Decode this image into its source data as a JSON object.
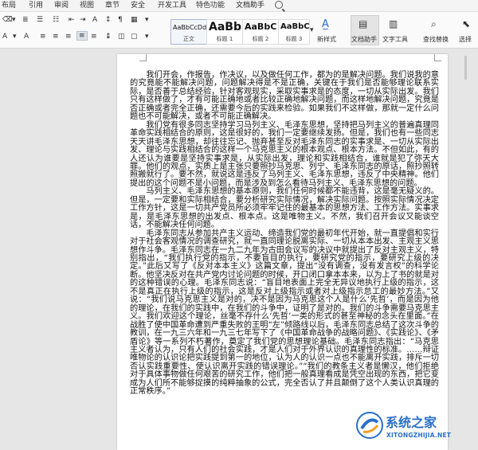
{
  "menu": {
    "items": [
      "布局",
      "引用",
      "审阅",
      "视图",
      "章节",
      "安全",
      "开发工具",
      "特色功能",
      "文档助手"
    ]
  },
  "ribbon": {
    "styles": [
      {
        "sample": "AaBbCcDd",
        "label": "正文"
      },
      {
        "sample": "AaBb",
        "label": "标题 1"
      },
      {
        "sample": "AaBbC",
        "label": "标题 2"
      },
      {
        "sample": "AaBbC",
        "label": "标题 3"
      }
    ],
    "new_style_label": "新样式",
    "doc_assistant_label": "文档助手",
    "text_tools_label": "文字工具",
    "find_replace_label": "查找替换",
    "select_label": "选择"
  },
  "document": {
    "paragraphs": [
      "我们开会，作报告，作决议，以及做任何工作，都为的是解决问题。我们说我的意的究竟能不能解决问题，问题解决得是不是正确，关键在于我们是否能够理论联系实际，是否善于总结经验，针对客观现实，采取实事求是的态度，一切从实际出发。我们只有这样做了，才有可能正确地或者比较正确地解决问题，而这样地解决问题，究竟是否正确或者完全正确，还需要今后的实践来检验。如果我们不这样做，那就一定什么问题也不可能解决，或者不可能正确解决。",
      "我们党有很多同志坚持学习马列主义、毛泽东思想，坚持把马列主义的普遍真理同革命实践相结合的原则，这是很好的，我们一定要继续发扬。但是，我们也有一些同志天天讲毛泽东思想，却往往忘记、抛弃甚至反对毛泽东同志的实事求是、一切从实际出发、理论与实践相结合的这样一个马克思主义的根本观点、根本方法。不但如此，有的人还认为谁要是坚持实事求是，从实际出发，理论和实践相结合，谁就是犯了弥天大罪。他们的观点，实质上是主张只要照抄马克思、列宁、毛泽东同志的原话，照抄照转照搬就行了。要不然，就说这是违反了马列主义、毛泽东思想，违反了中央精神。他们提出的这个问题不是小问题，而是涉及到怎么看待马列主义、毛泽东思想的问题。",
      "马列主义、毛泽东思想的基本原则，我们任何时候都不能违背，这是毫无疑义的。但是，一定要和实际相结合，要分析研究实际情况，解决实际问题。按照实际情况决定工作方针，这是一切共产党员所必须牢牢记住的最基本的思想方法、工作方法。实事求是，是毛泽东思想的出发点、根本点。这是唯物主义。不然，我们召开会议又能谈空话，不能解决任何问题。",
      "毛泽东同志从参加共产主义运动、缔造我们党的最初年代开始，就一直提倡和实行对于社会客观情况的调查研究，就一直同理论脱离实际、一切从本本出发、主观主义思想作斗争。毛泽东同志在一九二九年为古田会议写的决议中就提出了反对主观主义，特别指出，“我们执行党的指示，不要盲目的执行，要研究党的指示，要研究上级的决定。”此后又写了《反对本本主义》这篇文章，提出“没有调查，没有发言权”的科学论断。他坚决反对在共产党内讨论问题的时候，开口闭口拿本本来，以为上了书的就是对的这种错误的心理。毛泽东同志说：“盲目地表面上完全无异议地执行上级的指示，这不是真正在执行上级的指示，这是反对上级指示或者对上级指示怠工的最妙方法。”又说：“我们说马克思主义是对的，决不是因为马克思这个人是什么‘先哲’，而是因为他的理论，在我们的实践中，在我们的斗争中，证明了是对的。我们的斗争需要马克思主义。我们欢迎这个理论，丝毫不存什么‘先哲’一类的形式的甚至神秘的念头在里面。”在战胜了使中国革命遭到严重失败的王明“左”倾路线以后，毛泽东同志总结了这次斗争的教训，在一九三六年和一九三七年写下了《中国革命战争的战略问题》、《实践论》、《矛盾论》等一系列不朽著作，奠定了我们党的思想理论基础。毛泽东同志指出：“马克思主义者认为，只有人们的社会实践，才是人们对于外界认识的真理性的标准。……辩证唯物论的认识论把实践提到第一的地位，认为人的认识一点也不能离开实践，排斥一切否认实践重要性、使认识离开实践的错误理论。”“我们的教条主义者是懒汉，他们拒绝对于具体事物做任何艰苦的研究工作，他们把一般真理看成是凭空出现的东西，把它变成为人们所不能够捉摸的纯粹抽象的公式，完全否认了并且颠倒了这个人类认识真理的正常秩序。”"
    ]
  },
  "watermark": {
    "text_cn": "系统之家",
    "text_en": "XITONGZHIJIA.NET"
  },
  "colors": {
    "accent": "#2a6fc9",
    "page": "#ffffff",
    "canvas": "#e6e6e6"
  }
}
